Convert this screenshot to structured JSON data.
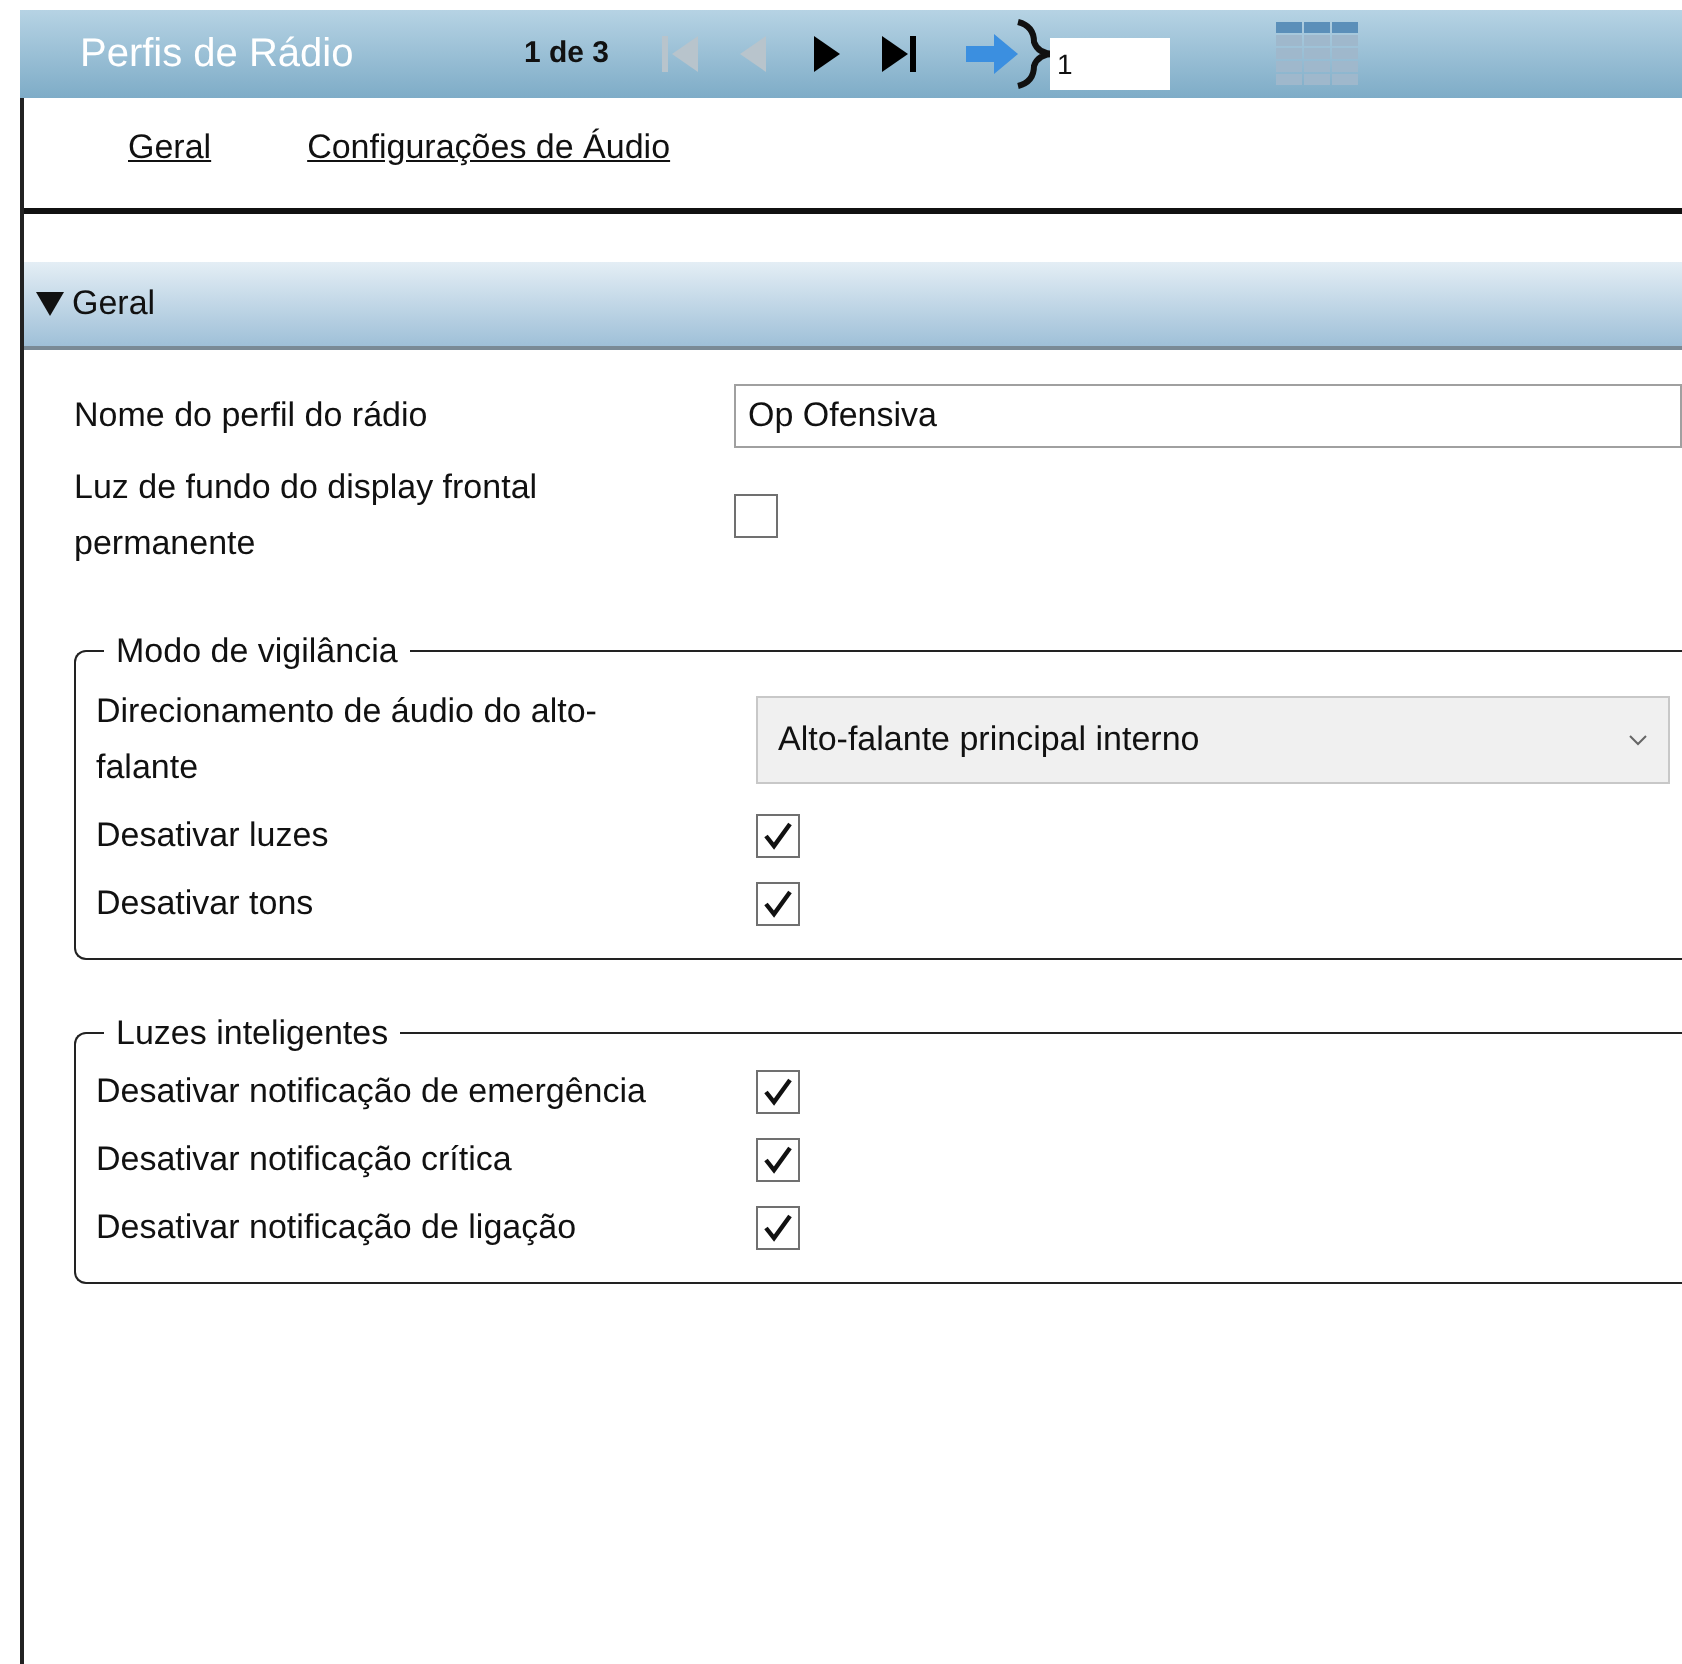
{
  "header": {
    "title": "Perfis de Rádio",
    "record_position": "1 de 3",
    "nav_buttons": [
      {
        "kind": "first",
        "disabled": true
      },
      {
        "kind": "previous",
        "disabled": true
      },
      {
        "kind": "next",
        "disabled": false
      },
      {
        "kind": "last",
        "disabled": false
      }
    ],
    "goto_value": "1"
  },
  "tabs": [
    {
      "label": "Geral"
    },
    {
      "label": "Configurações de Áudio"
    }
  ],
  "section": {
    "title": "Geral",
    "expanded": true,
    "rows": [
      {
        "kind": "text",
        "label": "Nome do perfil do rádio",
        "value": "Op Ofensiva"
      },
      {
        "kind": "checkbox",
        "label": "Luz de fundo do display frontal permanente",
        "checked": false
      }
    ],
    "groups": [
      {
        "title": "Modo de vigilância",
        "rows": [
          {
            "kind": "dropdown",
            "label": "Direcionamento de áudio do alto-falante",
            "value": "Alto-falante principal interno"
          },
          {
            "kind": "checkbox",
            "label": "Desativar luzes",
            "checked": true
          },
          {
            "kind": "checkbox",
            "label": "Desativar tons",
            "checked": true
          }
        ]
      },
      {
        "title": "Luzes inteligentes",
        "rows": [
          {
            "kind": "checkbox",
            "label": "Desativar notificação de emergência",
            "checked": true
          },
          {
            "kind": "checkbox",
            "label": "Desativar notificação crítica",
            "checked": true
          },
          {
            "kind": "checkbox",
            "label": "Desativar notificação de ligação",
            "checked": true
          }
        ]
      }
    ]
  }
}
